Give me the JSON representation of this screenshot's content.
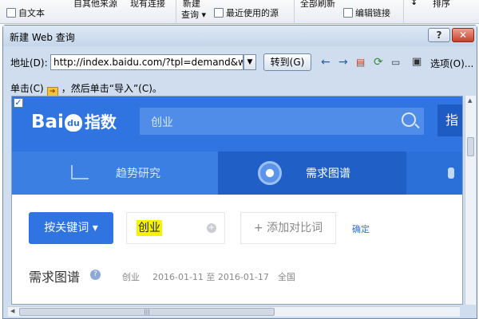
{
  "ribbon": {
    "from_text": "自文本",
    "other_sources": "自其他来源",
    "existing_connections": "现有连接",
    "new_query_top": "新建",
    "new_query": "查询",
    "recent_sources": "最近使用的源",
    "refresh_all": "全部刷新",
    "edit_links": "编辑链接",
    "sort": "排序"
  },
  "dialog": {
    "title": "新建 Web 查询",
    "help_label": "?",
    "close_label": "✕",
    "address_label": "地址(D):",
    "address_value": "http://index.baidu.com/?tpl=demand&word=创业",
    "goto_label": "转到(G)",
    "options_label": "选项(O)...",
    "instruction_before": "单击(C)",
    "instruction_after": "，然后单击“导入”(C)。",
    "instruction_arrow": "➔"
  },
  "web": {
    "logo_text1": "Bai",
    "logo_paw": "du",
    "logo_text2": "指数",
    "search_placeholder": "创业",
    "side_button": "指",
    "nav": [
      {
        "label": "趋势研究"
      },
      {
        "label": "需求图谱"
      }
    ],
    "keyword_button": "按关键词 ▾",
    "keyword_value": "创业",
    "plus": "+",
    "add_compare": "+ 添加对比词",
    "confirm": "确定",
    "section_title": "需求图谱",
    "help_icon_text": "?",
    "meta_keyword": "创业",
    "meta_dates": "2016-01-11 至 2016-01-17",
    "meta_region": "全国"
  },
  "colors": {
    "baidu_blue": "#2f74e0",
    "nav_active": "#1f5fc6",
    "highlight": "#f7f300",
    "dialog_bg": "#cfddef"
  }
}
